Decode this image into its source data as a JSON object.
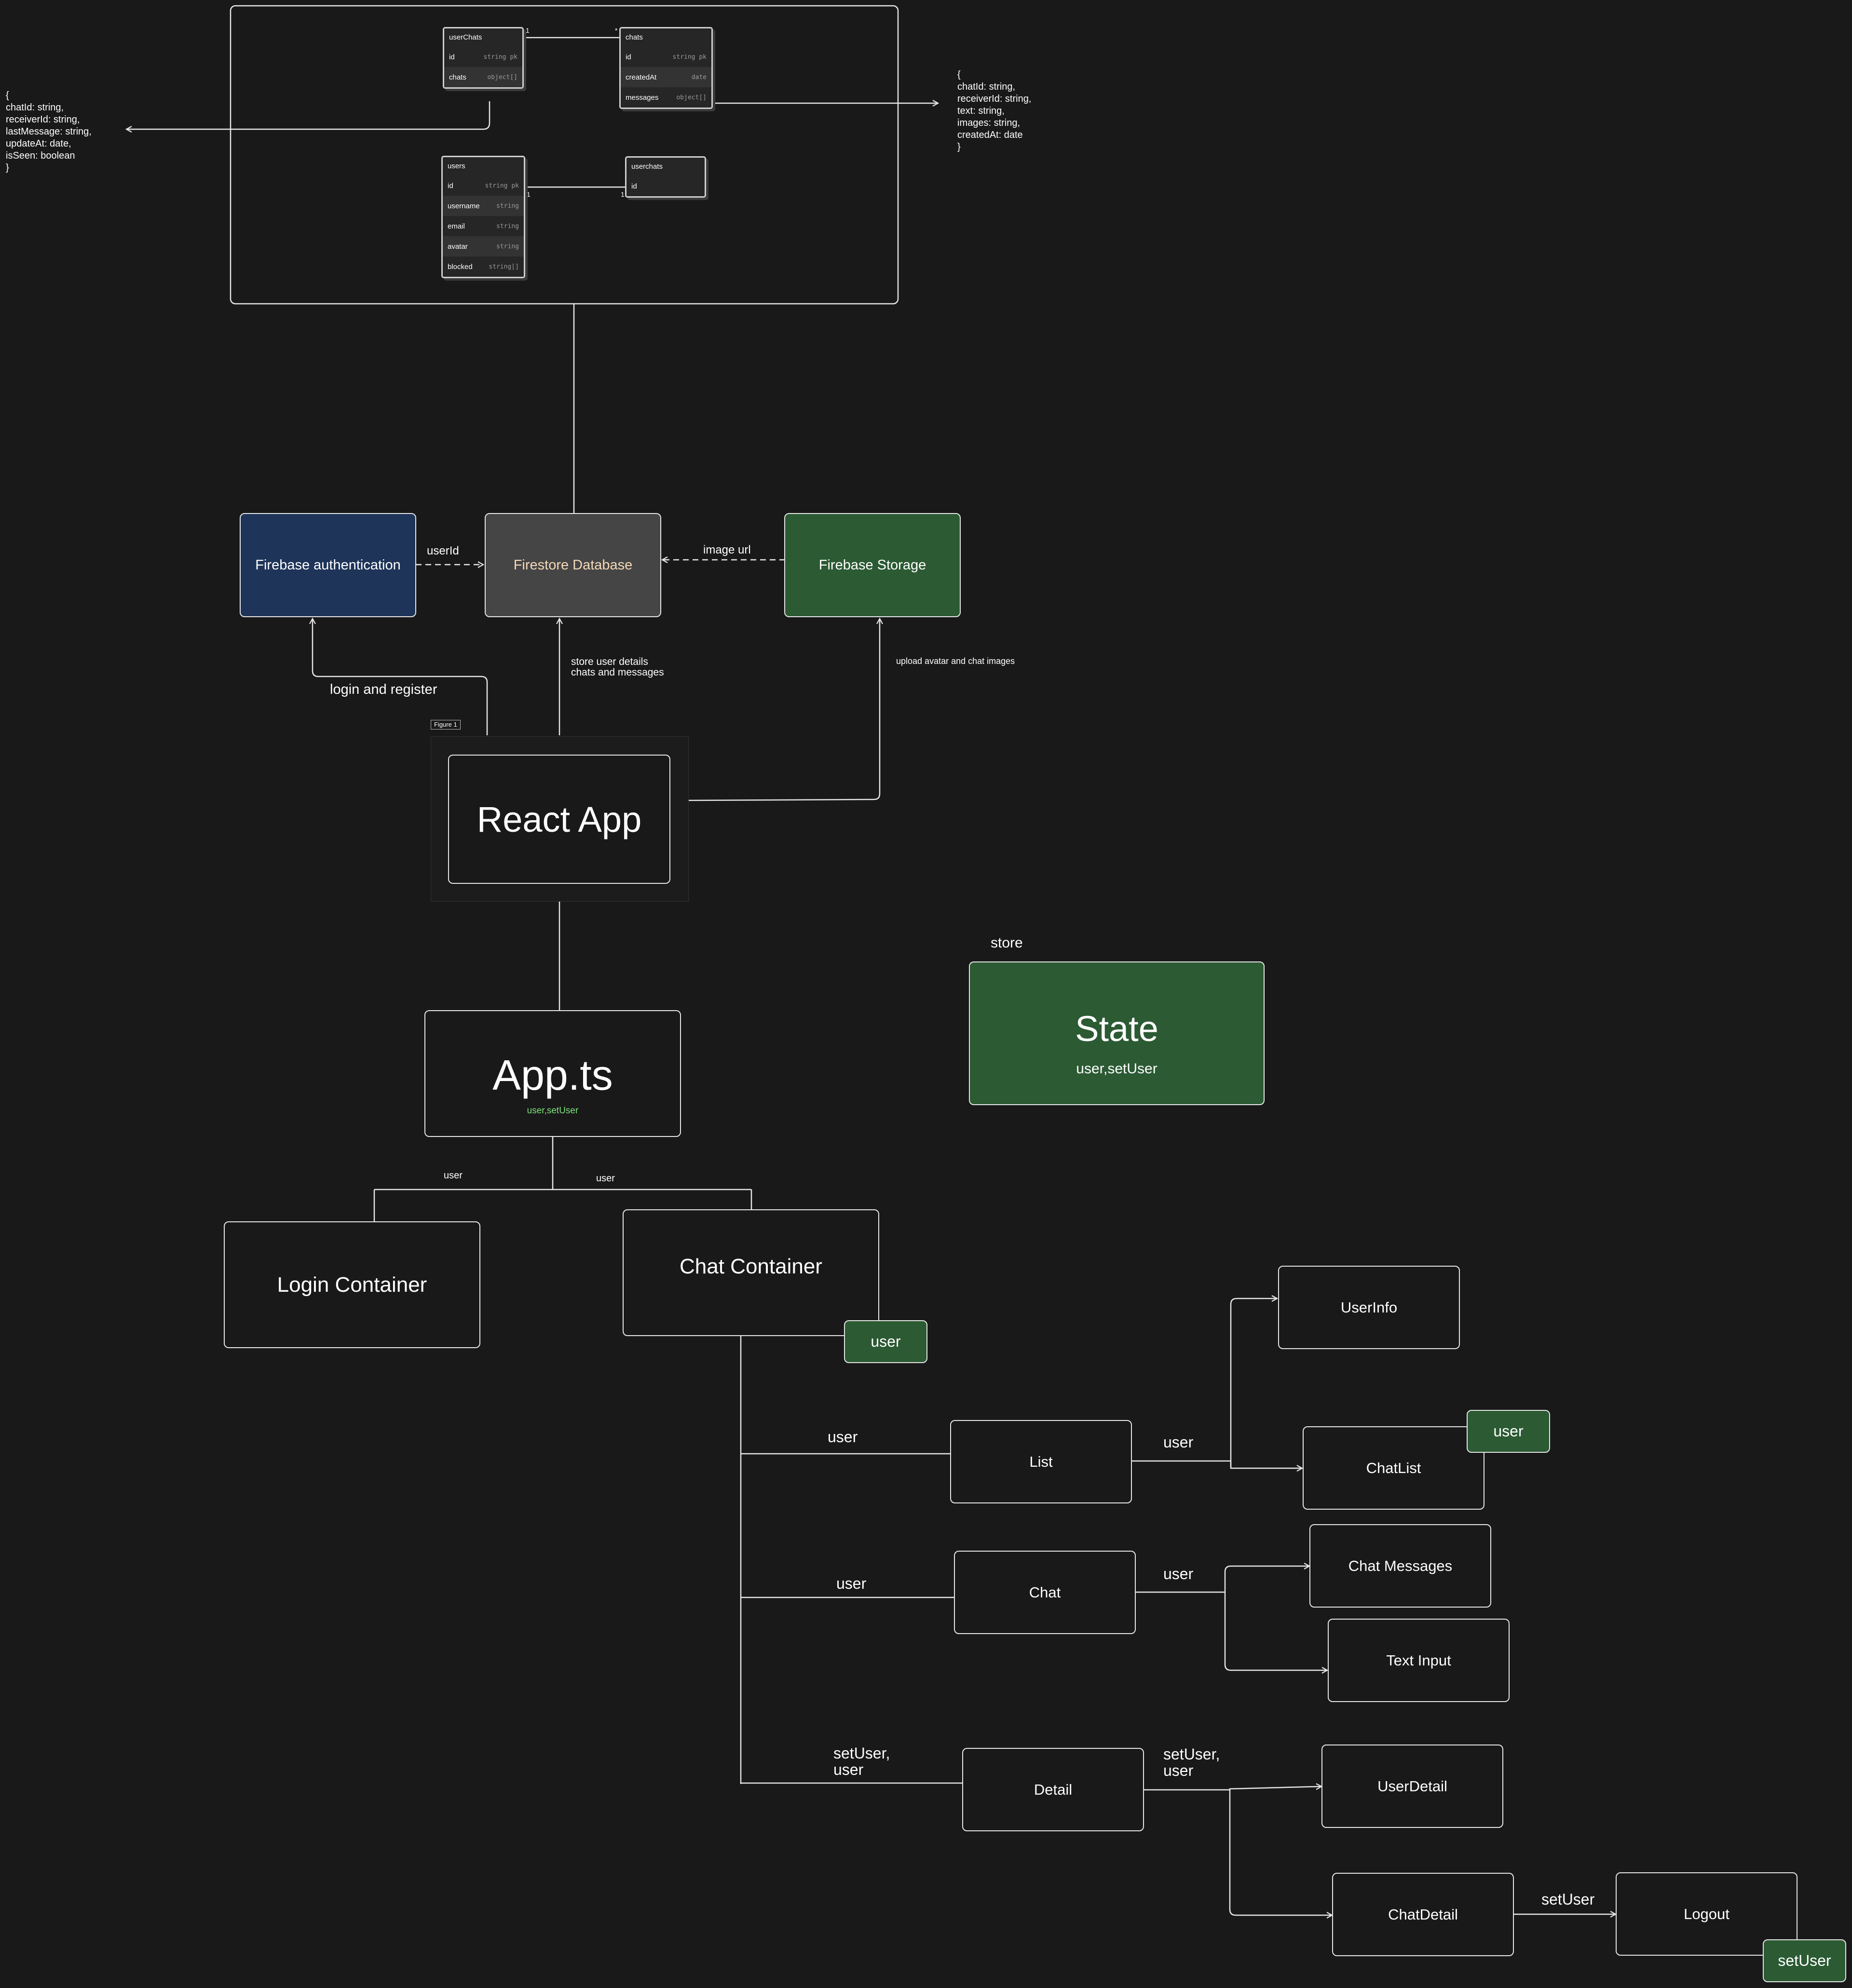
{
  "schema": {
    "tables": {
      "userChats": {
        "name": "userChats",
        "rows": [
          {
            "field": "id",
            "type": "string pk"
          },
          {
            "field": "chats",
            "type": "object[]"
          }
        ]
      },
      "chats": {
        "name": "chats",
        "rows": [
          {
            "field": "id",
            "type": "string pk"
          },
          {
            "field": "createdAt",
            "type": "date"
          },
          {
            "field": "messages",
            "type": "object[]"
          }
        ]
      },
      "users": {
        "name": "users",
        "rows": [
          {
            "field": "id",
            "type": "string pk"
          },
          {
            "field": "username",
            "type": "string"
          },
          {
            "field": "email",
            "type": "string"
          },
          {
            "field": "avatar",
            "type": "string"
          },
          {
            "field": "blocked",
            "type": "string[]"
          }
        ]
      },
      "userchats": {
        "name": "userchats",
        "rows": [
          {
            "field": "id",
            "type": ""
          }
        ]
      }
    },
    "cardinality": {
      "userChats_chats_left": "1",
      "userChats_chats_right": "*",
      "users_userchats_left": "1",
      "users_userchats_right": "1"
    },
    "chat_item_shape": "{\nchatId: string,\nreceiverId: string,\nlastMessage: string,\nupdateAt: date,\nisSeen: boolean\n}",
    "message_shape": "{\nchatId: string,\nreceiverId: string,\ntext: string,\nimages: string,\ncreatedAt: date\n}"
  },
  "services": {
    "auth": "Firebase authentication",
    "db": "Firestore Database",
    "storage": "Firebase Storage",
    "edge_userid": "userId",
    "edge_image_url": "image url",
    "edge_login": "login and register",
    "edge_store": "store user details\nchats and messages",
    "edge_upload": "upload avatar and chat images"
  },
  "app": {
    "figure_label": "Figure 1",
    "react_app": "React App",
    "app_ts": "App.ts",
    "app_ts_props": "user,setUser",
    "store_label": "store",
    "state_title": "State",
    "state_props": "user,setUser"
  },
  "tree": {
    "login_container": "Login Container",
    "chat_container": "Chat Container",
    "edge_user_login": "user",
    "edge_user_chat": "user",
    "chat_container_badge": "user",
    "list": "List",
    "chat": "Chat",
    "detail": "Detail",
    "edge_list": "user",
    "edge_chat": "user",
    "edge_detail": "setUser,\nuser",
    "userinfo": "UserInfo",
    "chatlist": "ChatList",
    "chatlist_badge": "user",
    "edge_list_children": "user",
    "chat_messages": "Chat Messages",
    "text_input": "Text Input",
    "edge_chat_children": "user",
    "user_detail": "UserDetail",
    "chat_detail": "ChatDetail",
    "edge_detail_children": "setUser,\nuser",
    "logout": "Logout",
    "edge_logout": "setUser",
    "logout_badge": "setUser"
  },
  "colors": {
    "background": "#191919",
    "green": "#2b5a33",
    "blue": "#1e3458",
    "grey": "#454545",
    "highlight_text": "#7de07d",
    "db_text": "#f3d9b8"
  }
}
